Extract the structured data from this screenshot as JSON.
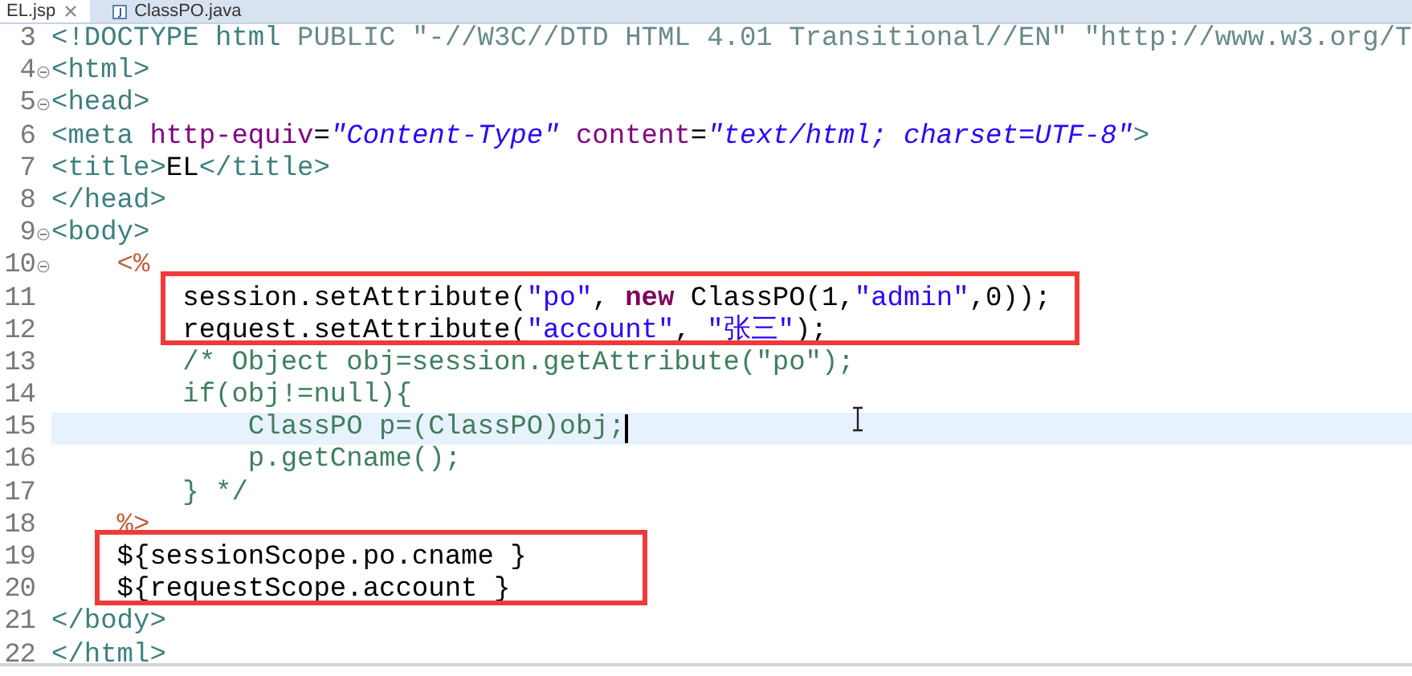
{
  "tabs": [
    {
      "label": "EL.jsp",
      "selected": true,
      "closable": true,
      "kind": "jsp"
    },
    {
      "label": "ClassPO.java",
      "selected": false,
      "closable": false,
      "kind": "java"
    }
  ],
  "lines": [
    {
      "number": "3",
      "fold": false,
      "boxed": false,
      "current": false,
      "caret": false,
      "tokens": [
        {
          "kind": "tag",
          "text": "<!DOCTYPE html"
        },
        {
          "kind": "doctype",
          "text": " PUBLIC \"-//W3C//DTD HTML 4.01 Transitional//EN\" \"http://www.w3.org/T"
        }
      ]
    },
    {
      "number": "4",
      "fold": true,
      "boxed": false,
      "current": false,
      "caret": false,
      "tokens": [
        {
          "kind": "tag",
          "text": "<html>"
        }
      ]
    },
    {
      "number": "5",
      "fold": true,
      "boxed": false,
      "current": false,
      "caret": false,
      "tokens": [
        {
          "kind": "tag",
          "text": "<head>"
        }
      ]
    },
    {
      "number": "6",
      "fold": false,
      "boxed": false,
      "current": false,
      "caret": false,
      "tokens": [
        {
          "kind": "tag",
          "text": "<meta "
        },
        {
          "kind": "attr",
          "text": "http-equiv"
        },
        {
          "kind": "plain",
          "text": "="
        },
        {
          "kind": "string",
          "text": "\"Content-Type\""
        },
        {
          "kind": "attr",
          "text": " content"
        },
        {
          "kind": "plain",
          "text": "="
        },
        {
          "kind": "string",
          "text": "\"text/html; charset=UTF-8\""
        },
        {
          "kind": "tag",
          "text": ">"
        }
      ]
    },
    {
      "number": "7",
      "fold": false,
      "boxed": false,
      "current": false,
      "caret": false,
      "tokens": [
        {
          "kind": "tag",
          "text": "<title>"
        },
        {
          "kind": "plain",
          "text": "EL"
        },
        {
          "kind": "tag",
          "text": "</title>"
        }
      ]
    },
    {
      "number": "8",
      "fold": false,
      "boxed": false,
      "current": false,
      "caret": false,
      "tokens": [
        {
          "kind": "tag",
          "text": "</head>"
        }
      ]
    },
    {
      "number": "9",
      "fold": true,
      "boxed": false,
      "current": false,
      "caret": false,
      "tokens": [
        {
          "kind": "tag",
          "text": "<body>"
        }
      ]
    },
    {
      "number": "10",
      "fold": true,
      "boxed": false,
      "current": false,
      "caret": false,
      "tokens": [
        {
          "kind": "jsp",
          "text": "    <%"
        }
      ]
    },
    {
      "number": "11",
      "fold": false,
      "boxed": true,
      "current": false,
      "caret": false,
      "tokens": [
        {
          "kind": "plain",
          "text": "        session.setAttribute("
        },
        {
          "kind": "jstring",
          "text": "\"po\""
        },
        {
          "kind": "plain",
          "text": ", "
        },
        {
          "kind": "keyword",
          "text": "new"
        },
        {
          "kind": "plain",
          "text": " ClassPO(1,"
        },
        {
          "kind": "jstring",
          "text": "\"admin\""
        },
        {
          "kind": "plain",
          "text": ",0));"
        }
      ]
    },
    {
      "number": "12",
      "fold": false,
      "boxed": true,
      "current": false,
      "caret": false,
      "tokens": [
        {
          "kind": "plain",
          "text": "        request.setAttribute("
        },
        {
          "kind": "jstring",
          "text": "\"account\""
        },
        {
          "kind": "plain",
          "text": ", "
        },
        {
          "kind": "jstring",
          "text": "\"张三\""
        },
        {
          "kind": "plain",
          "text": ");"
        }
      ]
    },
    {
      "number": "13",
      "fold": false,
      "boxed": false,
      "current": false,
      "caret": false,
      "tokens": [
        {
          "kind": "comment",
          "text": "        /* Object obj=session.getAttribute(\"po\");"
        }
      ]
    },
    {
      "number": "14",
      "fold": false,
      "boxed": false,
      "current": false,
      "caret": false,
      "tokens": [
        {
          "kind": "comment",
          "text": "        if(obj!=null){"
        }
      ]
    },
    {
      "number": "15",
      "fold": false,
      "boxed": false,
      "current": true,
      "caret": true,
      "tokens": [
        {
          "kind": "comment",
          "text": "            ClassPO p=(ClassPO)obj;"
        }
      ]
    },
    {
      "number": "16",
      "fold": false,
      "boxed": false,
      "current": false,
      "caret": false,
      "tokens": [
        {
          "kind": "comment",
          "text": "            p.getCname();"
        }
      ]
    },
    {
      "number": "17",
      "fold": false,
      "boxed": false,
      "current": false,
      "caret": false,
      "tokens": [
        {
          "kind": "comment",
          "text": "        } */"
        }
      ]
    },
    {
      "number": "18",
      "fold": false,
      "boxed": false,
      "current": false,
      "caret": false,
      "tokens": [
        {
          "kind": "jsp",
          "text": "    %>"
        }
      ]
    },
    {
      "number": "19",
      "fold": false,
      "boxed": true,
      "current": false,
      "caret": false,
      "tokens": [
        {
          "kind": "plain",
          "text": "    ${sessionScope.po.cname }"
        }
      ]
    },
    {
      "number": "20",
      "fold": false,
      "boxed": true,
      "current": false,
      "caret": false,
      "tokens": [
        {
          "kind": "plain",
          "text": "    ${requestScope.account }"
        }
      ]
    },
    {
      "number": "21",
      "fold": false,
      "boxed": false,
      "current": false,
      "caret": false,
      "tokens": [
        {
          "kind": "tag",
          "text": "</body>"
        }
      ]
    },
    {
      "number": "22",
      "fold": false,
      "boxed": false,
      "current": false,
      "caret": false,
      "tokens": [
        {
          "kind": "tag",
          "text": "</html>"
        }
      ]
    }
  ]
}
